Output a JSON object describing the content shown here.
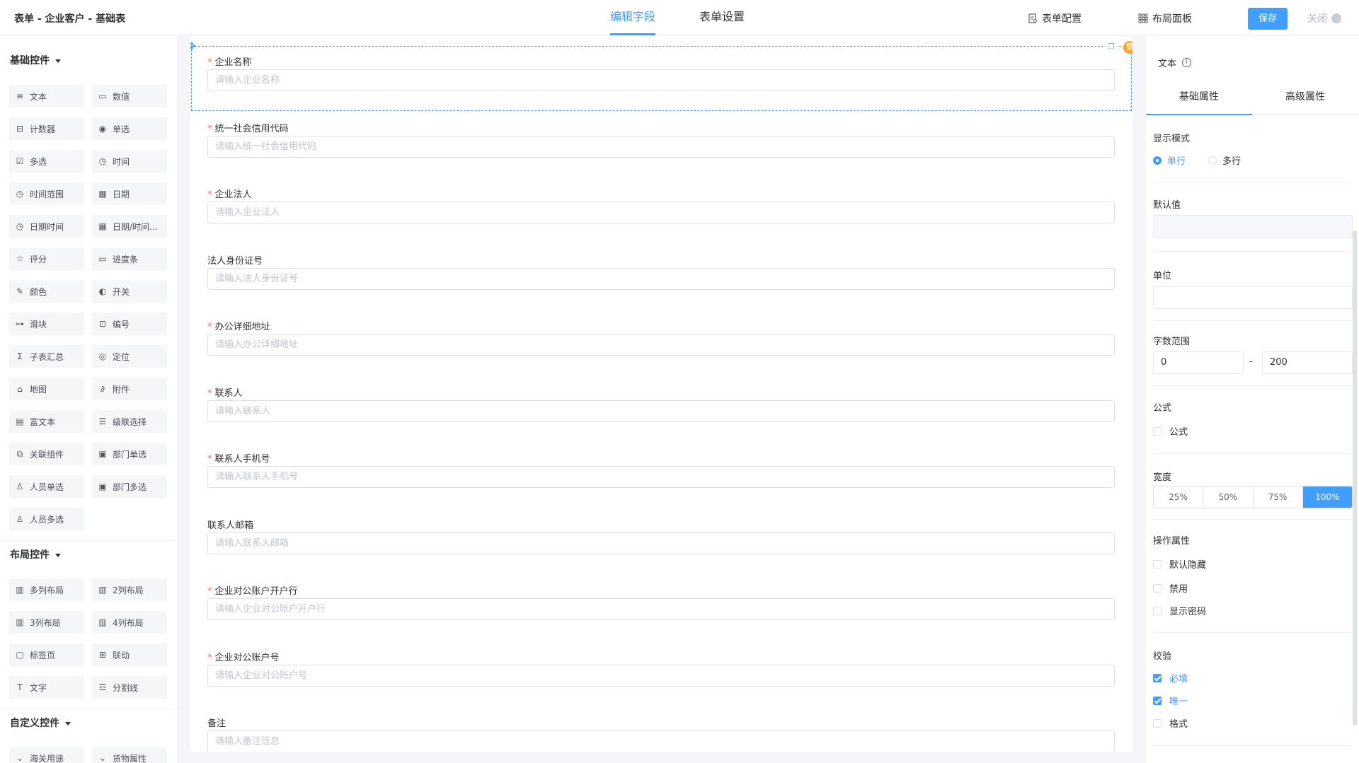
{
  "header": {
    "breadcrumb": "表单 - 企业客户 - 基础表",
    "tabs": [
      {
        "label": "编辑字段",
        "active": true
      },
      {
        "label": "表单设置",
        "active": false
      }
    ],
    "form_config_label": "表单配置",
    "layout_panel_label": "布局面板",
    "save_label": "保存",
    "close_label": "关闭",
    "accent_color": "#409eff"
  },
  "left": {
    "basic_title": "基础控件",
    "basic": [
      {
        "label": "文本",
        "icon": "text-icon"
      },
      {
        "label": "数值",
        "icon": "number-icon"
      },
      {
        "label": "计数器",
        "icon": "counter-icon"
      },
      {
        "label": "单选",
        "icon": "radio-icon"
      },
      {
        "label": "多选",
        "icon": "checkbox-icon"
      },
      {
        "label": "时间",
        "icon": "clock-icon"
      },
      {
        "label": "时间范围",
        "icon": "clock-icon"
      },
      {
        "label": "日期",
        "icon": "calendar-icon"
      },
      {
        "label": "日期时间",
        "icon": "clock-icon"
      },
      {
        "label": "日期/时间...",
        "icon": "calendar-icon"
      },
      {
        "label": "评分",
        "icon": "star-icon"
      },
      {
        "label": "进度条",
        "icon": "progress-icon"
      },
      {
        "label": "颜色",
        "icon": "color-picker-icon"
      },
      {
        "label": "开关",
        "icon": "toggle-icon"
      },
      {
        "label": "滑块",
        "icon": "slider-icon"
      },
      {
        "label": "编号",
        "icon": "serial-icon"
      },
      {
        "label": "子表汇总",
        "icon": "sigma-icon"
      },
      {
        "label": "定位",
        "icon": "location-icon"
      },
      {
        "label": "地图",
        "icon": "map-icon"
      },
      {
        "label": "附件",
        "icon": "paperclip-icon"
      },
      {
        "label": "富文本",
        "icon": "rich-text-icon"
      },
      {
        "label": "级联选择",
        "icon": "cascade-icon"
      },
      {
        "label": "关联组件",
        "icon": "link-component-icon"
      },
      {
        "label": "部门单选",
        "icon": "department-icon"
      },
      {
        "label": "人员单选",
        "icon": "user-icon"
      },
      {
        "label": "部门多选",
        "icon": "department-icon"
      },
      {
        "label": "人员多选",
        "icon": "users-icon"
      }
    ],
    "layout_title": "布局控件",
    "layout": [
      {
        "label": "多列布局",
        "icon": "columns-icon"
      },
      {
        "label": "2列布局",
        "icon": "columns-icon"
      },
      {
        "label": "3列布局",
        "icon": "columns-icon"
      },
      {
        "label": "4列布局",
        "icon": "columns-icon"
      },
      {
        "label": "标签页",
        "icon": "tabs-icon"
      },
      {
        "label": "联动",
        "icon": "grid-icon"
      },
      {
        "label": "文字",
        "icon": "text-t-icon"
      },
      {
        "label": "分割线",
        "icon": "divider-icon"
      }
    ],
    "custom_title": "自定义控件",
    "custom": [
      {
        "label": "海关用途",
        "icon": "chevron-down-icon"
      },
      {
        "label": "货物属性",
        "icon": "chevron-down-icon"
      }
    ]
  },
  "canvas": {
    "fields": [
      {
        "label": "企业名称",
        "required": true,
        "placeholder": "请输入企业名称"
      },
      {
        "label": "统一社会信用代码",
        "required": true,
        "placeholder": "请输入统一社会信用代码"
      },
      {
        "label": "企业法人",
        "required": true,
        "placeholder": "请输入企业法人"
      },
      {
        "label": "法人身份证号",
        "required": false,
        "placeholder": "请输入法人身份证号"
      },
      {
        "label": "办公详细地址",
        "required": true,
        "placeholder": "请输入办公详细地址"
      },
      {
        "label": "联系人",
        "required": true,
        "placeholder": "请输入联系人"
      },
      {
        "label": "联系人手机号",
        "required": true,
        "placeholder": "请输入联系人手机号"
      },
      {
        "label": "联系人邮箱",
        "required": false,
        "placeholder": "请输入联系人邮箱"
      },
      {
        "label": "企业对公账户开户行",
        "required": true,
        "placeholder": "请输入企业对公账户开户行"
      },
      {
        "label": "企业对公账户号",
        "required": true,
        "placeholder": "请输入企业对公账户号"
      },
      {
        "label": "备注",
        "required": false,
        "placeholder": "请输入备注信息"
      }
    ]
  },
  "right": {
    "title": "文本",
    "tabs": [
      {
        "label": "基础属性",
        "active": true
      },
      {
        "label": "高级属性",
        "active": false
      }
    ],
    "display_mode_label": "显示模式",
    "display_modes": [
      {
        "label": "单行",
        "checked": true
      },
      {
        "label": "多行",
        "checked": false
      }
    ],
    "default_value_label": "默认值",
    "default_value": "",
    "unit_label": "单位",
    "unit_value": "",
    "length_range_label": "字数范围",
    "length_min": "0",
    "length_sep": "-",
    "length_max": "200",
    "formula_label": "公式",
    "formula_check": {
      "label": "公式",
      "checked": false
    },
    "width_label": "宽度",
    "widths": [
      {
        "label": "25%",
        "active": false
      },
      {
        "label": "50%",
        "active": false
      },
      {
        "label": "75%",
        "active": false
      },
      {
        "label": "100%",
        "active": true
      }
    ],
    "ops_label": "操作属性",
    "ops": [
      {
        "label": "默认隐藏",
        "checked": false
      },
      {
        "label": "禁用",
        "checked": false
      },
      {
        "label": "显示密码",
        "checked": false
      }
    ],
    "validation_label": "校验",
    "validation": [
      {
        "label": "必填",
        "checked": true
      },
      {
        "label": "唯一",
        "checked": true
      },
      {
        "label": "格式",
        "checked": false
      }
    ]
  }
}
